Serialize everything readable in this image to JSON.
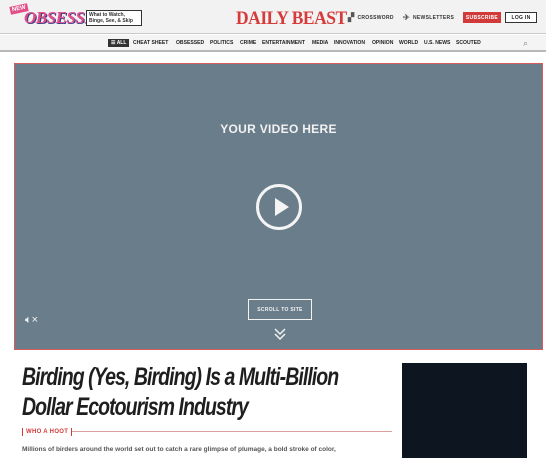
{
  "header": {
    "new_badge": "NEW",
    "obsessed_logo": "OBSESSED",
    "tagline": "What to Watch, Binge, See, & Skip",
    "brand_logo": "DAILY BEAST",
    "crossword_label": "CROSSWORD",
    "newsletters_label": "NEWSLETTERS",
    "subscribe_label": "SUBSCRIBE",
    "login_label": "LOG IN"
  },
  "nav": {
    "all_label": "ALL",
    "items": [
      "CHEAT SHEET",
      "OBSESSED",
      "POLITICS",
      "CRIME",
      "ENTERTAINMENT",
      "MEDIA",
      "INNOVATION",
      "OPINION",
      "WORLD",
      "U.S. NEWS",
      "SCOUTED"
    ]
  },
  "video": {
    "placeholder_text": "YOUR VIDEO HERE",
    "scroll_label": "SCROLL TO SITE",
    "icons": [
      "play-icon",
      "mute-icon",
      "chevron-double-down-icon"
    ]
  },
  "article": {
    "headline": "Birding (Yes, Birding) Is a Multi-Billion Dollar Ecotourism Industry",
    "section": "WHO A HOOT",
    "dek": "Millions of birders around the world set out to catch a rare glimpse of plumage, a bold stroke of color,"
  },
  "colors": {
    "accent_red": "#d23a3a",
    "obsessed_pink": "#e34d87",
    "video_bg": "#6a7d8b"
  }
}
